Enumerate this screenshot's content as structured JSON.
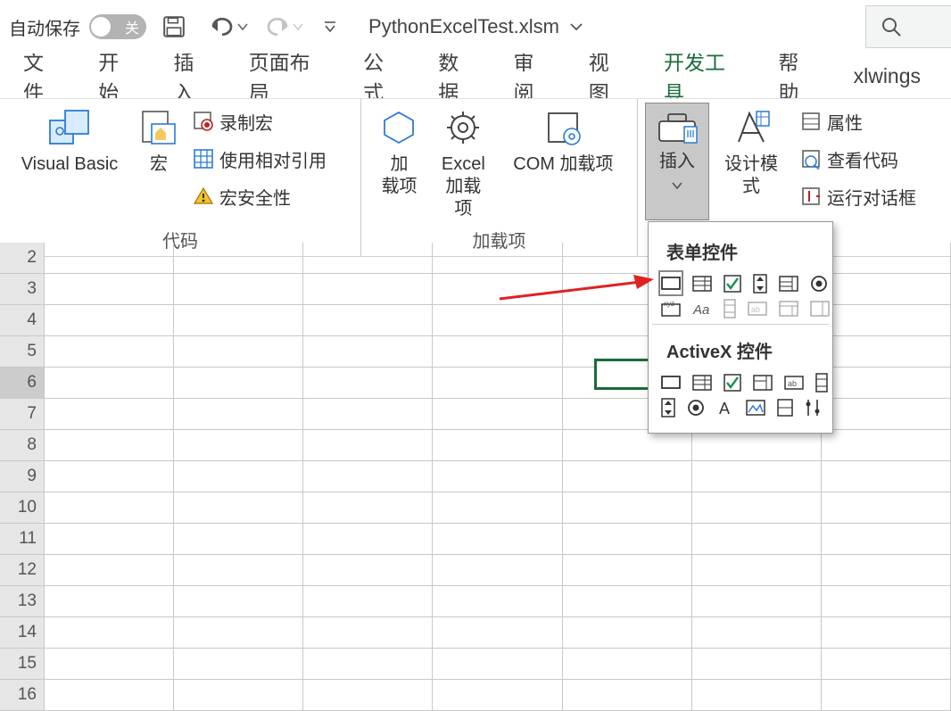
{
  "titlebar": {
    "autosave_label": "自动保存",
    "toggle_label": "关",
    "file_name": "PythonExcelTest.xlsm"
  },
  "tabs": {
    "items": [
      {
        "label": "文件"
      },
      {
        "label": "开始"
      },
      {
        "label": "插入"
      },
      {
        "label": "页面布局"
      },
      {
        "label": "公式"
      },
      {
        "label": "数据"
      },
      {
        "label": "审阅"
      },
      {
        "label": "视图"
      },
      {
        "label": "开发工具"
      },
      {
        "label": "帮助"
      },
      {
        "label": "xlwings"
      }
    ]
  },
  "ribbon": {
    "visual_basic": "Visual Basic",
    "macros": "宏",
    "record_macro": "录制宏",
    "relative_ref": "使用相对引用",
    "macro_security": "宏安全性",
    "group_code": "代码",
    "addins": "加\n载项",
    "excel_addins": "Excel\n加载项",
    "com_addins": "COM 加载项",
    "group_addins": "加载项",
    "insert": "插入",
    "design_mode": "设计模式",
    "properties": "属性",
    "view_code": "查看代码",
    "run_dialog": "运行对话框"
  },
  "popup": {
    "form_title": "表单控件",
    "activex_title": "ActiveX 控件"
  },
  "rows": [
    "2",
    "3",
    "4",
    "5",
    "6",
    "7",
    "8",
    "9",
    "10",
    "11",
    "12",
    "13",
    "14",
    "15",
    "16"
  ],
  "selected_row": "6"
}
